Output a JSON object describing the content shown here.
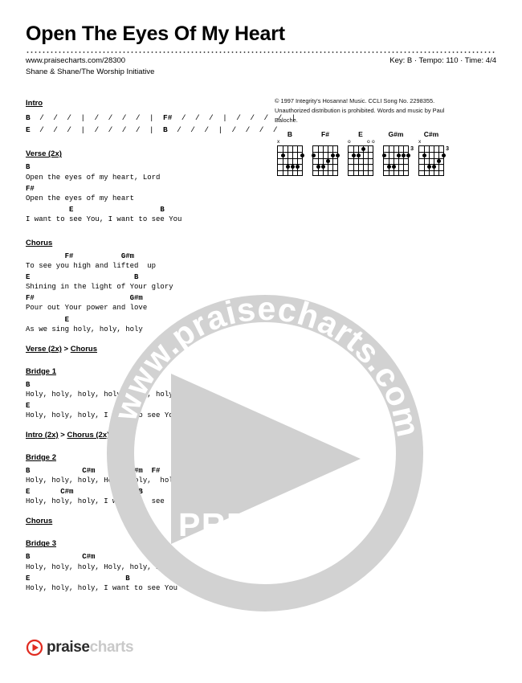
{
  "header": {
    "title": "Open The Eyes Of My Heart",
    "source_url": "www.praisecharts.com/28300",
    "artist": "Shane & Shane/The Worship Initiative",
    "meta": "Key: B · Tempo: 110 · Time: 4/4",
    "key": "B",
    "tempo": "110",
    "time_signature": "4/4"
  },
  "copyright": "© 1997 Integrity's Hosanna! Music. CCLI Song No. 2298355. Unauthorized distribution is prohibited. Words and music by Paul Baloche.",
  "chord_diagrams": [
    {
      "name": "B",
      "open_marks": [
        "x",
        "",
        "",
        "",
        "",
        ""
      ],
      "base_fret": "",
      "dots": [
        [
          2,
          2
        ],
        [
          4,
          3
        ],
        [
          4,
          4
        ],
        [
          4,
          5
        ],
        [
          2,
          6
        ]
      ]
    },
    {
      "name": "F#",
      "open_marks": [
        "",
        "",
        "",
        "",
        "",
        ""
      ],
      "base_fret": "",
      "dots": [
        [
          2,
          1
        ],
        [
          4,
          2
        ],
        [
          4,
          3
        ],
        [
          3,
          4
        ],
        [
          2,
          5
        ],
        [
          2,
          6
        ]
      ]
    },
    {
      "name": "E",
      "open_marks": [
        "o",
        "",
        "",
        "",
        "o",
        "o"
      ],
      "base_fret": "",
      "dots": [
        [
          2,
          2
        ],
        [
          2,
          3
        ],
        [
          1,
          4
        ]
      ]
    },
    {
      "name": "G#m",
      "open_marks": [
        "",
        "",
        "",
        "",
        "",
        ""
      ],
      "base_fret": "3",
      "dots": [
        [
          2,
          1
        ],
        [
          4,
          2
        ],
        [
          4,
          3
        ],
        [
          2,
          4
        ],
        [
          2,
          5
        ],
        [
          2,
          6
        ]
      ]
    },
    {
      "name": "C#m",
      "open_marks": [
        "x",
        "",
        "",
        "",
        "",
        ""
      ],
      "base_fret": "3",
      "dots": [
        [
          2,
          2
        ],
        [
          4,
          3
        ],
        [
          4,
          4
        ],
        [
          3,
          5
        ],
        [
          2,
          6
        ]
      ]
    }
  ],
  "sections": [
    {
      "type": "measures",
      "label": "Intro",
      "lines": [
        [
          {
            "chord": "B"
          },
          {
            "slashes": " /  /  /  | "
          },
          {
            "slashes2": " /  /  /  /  | "
          },
          {
            "chord2": "F#"
          },
          {
            "slashes3": " /  /  /  | "
          },
          {
            "slashes4": " /  /  /  /  |"
          }
        ],
        [
          {
            "chord": "E"
          },
          {
            "slashes": " /  /  /  | "
          },
          {
            "slashes2": " /  /  /  /  | "
          },
          {
            "chord2": "B"
          },
          {
            "slashes3": " /  /  /  | "
          },
          {
            "slashes4": " /  /  /  /"
          }
        ]
      ],
      "line_text": [
        "B  /  /  /  |  /  /  /  /  |  F#  /  /  /  |  /  /  /  /  |",
        "E  /  /  /  |  /  /  /  /  |  B  /  /  /  |  /  /  /  /"
      ]
    },
    {
      "type": "lyrics",
      "label": "Verse (2x)",
      "lines": [
        {
          "chords": "B",
          "lyric": "Open the eyes of my heart, Lord"
        },
        {
          "chords": "F#",
          "lyric": "Open the eyes of my heart"
        },
        {
          "chords": "          E                    B",
          "lyric": "I want to see You, I want to see You"
        }
      ]
    },
    {
      "type": "lyrics",
      "label": "Chorus",
      "lines": [
        {
          "chords": "         F#           G#m",
          "lyric": "To see you high and lifted  up"
        },
        {
          "chords": "E                        B",
          "lyric": "Shining in the light of Your glory"
        },
        {
          "chords": "F#                      G#m",
          "lyric": "Pour out Your power and love"
        },
        {
          "chords": "         E",
          "lyric": "As we sing holy, holy, holy"
        }
      ]
    },
    {
      "type": "nav",
      "parts": [
        "Verse (2x)",
        ">",
        "Chorus"
      ]
    },
    {
      "type": "lyrics",
      "label": "Bridge 1",
      "lines": [
        {
          "chords": "B",
          "lyric": "Holy, holy, holy, holy, holy, holy"
        },
        {
          "chords": "E                      B",
          "lyric": "Holy, holy, holy, I want to see You"
        }
      ]
    },
    {
      "type": "nav",
      "parts": [
        "Intro (2x)",
        ">",
        "Chorus (2x)"
      ]
    },
    {
      "type": "lyrics",
      "label": "Bridge 2",
      "lines": [
        {
          "chords": "B            C#m        G#m  F#",
          "lyric": "Holy, holy, holy, Holy, holy,  holy"
        },
        {
          "chords": "E       C#m          G#m  B",
          "lyric": "Holy, holy, holy, I want to  see  You"
        }
      ]
    },
    {
      "type": "nav",
      "parts": [
        "Chorus"
      ]
    },
    {
      "type": "lyrics",
      "label": "Bridge 3",
      "lines": [
        {
          "chords": "B            C#m",
          "lyric": "Holy, holy, holy, Holy, holy, holy"
        },
        {
          "chords": "E                      B",
          "lyric": "Holy, holy, holy, I want to see You"
        }
      ]
    }
  ],
  "watermark": {
    "ring_text": "www.praisecharts.com",
    "preview_label": "PREVIEW",
    "color": "#d0d0d0"
  },
  "footer": {
    "logo_text_dark": "praise",
    "logo_text_light": "charts",
    "logo_accent": "#e02b20"
  }
}
